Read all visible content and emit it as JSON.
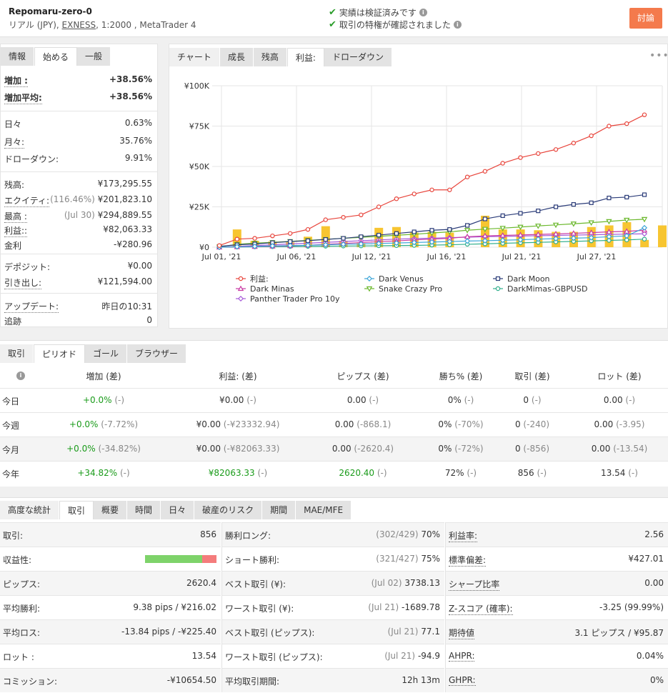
{
  "account": {
    "name": "Repomaru-zero-0",
    "sub_prefix": "リアル (JPY), ",
    "broker": "EXNESS",
    "sub_suffix": ", 1:2000 , MetaTrader 4",
    "verified_1": "実績は検証済みです",
    "verified_2": "取引の特権が確認されました",
    "discuss_label": "討論"
  },
  "left_tabs": [
    "情報",
    "始める",
    "一般"
  ],
  "stats": [
    {
      "k": "増加 :",
      "v": "+38.56%",
      "style": "green"
    },
    {
      "k": "増加平均:",
      "v": "+38.56%",
      "style": "green"
    },
    {
      "k": "日々",
      "v": "0.63%"
    },
    {
      "k": "月々:",
      "v": "35.76%"
    },
    {
      "k": "ドローダウン:",
      "v": "9.91%"
    },
    {
      "k": "残高:",
      "v": "¥173,295.55"
    },
    {
      "k": "エクイティ:",
      "pre": "(116.46%)",
      "v": "¥201,823.10"
    },
    {
      "k": "最高 :",
      "pre": "(Jul 30)",
      "v": "¥294,889.55"
    },
    {
      "k": "利益::",
      "v": "¥82,063.33",
      "style": "green"
    },
    {
      "k": "金利",
      "v": "-¥280.96"
    },
    {
      "k": "デポジット:",
      "v": "¥0.00"
    },
    {
      "k": "引き出し:",
      "v": "¥121,594.00"
    },
    {
      "k": "アップデート:",
      "v": "昨日の10:31"
    },
    {
      "k": "追跡",
      "v": "0"
    }
  ],
  "chart_tabs": [
    "チャート",
    "成長",
    "残高",
    "利益:",
    "ドローダウン"
  ],
  "chart_data": {
    "type": "line",
    "ylabels": [
      "¥100K",
      "¥75K",
      "¥50K",
      "¥25K",
      "¥0"
    ],
    "xlabels": [
      "Jul 01, '21",
      "Jul 06, '21",
      "Jul 12, '21",
      "Jul 16, '21",
      "Jul 21, '21",
      "Jul 27, '21"
    ],
    "ylim": [
      0,
      100000
    ],
    "series": [
      {
        "name": "利益:",
        "color": "#e8453c",
        "marker": "circle",
        "values": [
          1000,
          5000,
          5500,
          7000,
          8500,
          11000,
          17000,
          18500,
          20000,
          25000,
          30000,
          33000,
          35500,
          35500,
          43500,
          47000,
          52000,
          55500,
          58000,
          60500,
          64500,
          69000,
          75000,
          76500,
          82000
        ]
      },
      {
        "name": "Dark Venus",
        "color": "#3ba5d8",
        "marker": "diamond",
        "values": [
          0,
          300,
          500,
          800,
          1000,
          1200,
          1500,
          1800,
          2000,
          2300,
          2600,
          2900,
          3200,
          3500,
          3800,
          4000,
          4300,
          4600,
          5000,
          5300,
          5600,
          5900,
          6500,
          7000,
          12000
        ]
      },
      {
        "name": "Dark Moon",
        "color": "#2a3b78",
        "marker": "square",
        "values": [
          500,
          1500,
          2000,
          2800,
          3500,
          4000,
          4800,
          5500,
          6500,
          7500,
          8500,
          9500,
          10500,
          11000,
          13500,
          17500,
          19500,
          21000,
          22500,
          25000,
          26500,
          27500,
          30500,
          31000,
          32500
        ]
      },
      {
        "name": "Dark Minas",
        "color": "#c93aa3",
        "marker": "triangle",
        "values": [
          0,
          200,
          400,
          600,
          800,
          1200,
          1800,
          2300,
          2900,
          3400,
          3900,
          4500,
          5000,
          5500,
          6500,
          7000,
          7300,
          7600,
          7900,
          8200,
          8600,
          9000,
          9500,
          9800,
          10500
        ]
      },
      {
        "name": "Snake Crazy Pro",
        "color": "#6bb82c",
        "marker": "triangle-down",
        "values": [
          200,
          1800,
          2500,
          3000,
          3600,
          4200,
          4900,
          5500,
          6100,
          6700,
          7400,
          8000,
          8800,
          9500,
          10500,
          11200,
          11800,
          12500,
          13200,
          13800,
          14500,
          15200,
          16000,
          16800,
          17300
        ]
      },
      {
        "name": "DarkMimas-GBPUSD",
        "color": "#2fae8b",
        "marker": "circle",
        "values": [
          0,
          100,
          200,
          300,
          400,
          500,
          600,
          700,
          800,
          900,
          1000,
          1100,
          1300,
          1500,
          1800,
          2100,
          2400,
          2700,
          3000,
          3300,
          3600,
          3900,
          4200,
          4500,
          5000
        ]
      },
      {
        "name": "Panther Trader Pro 10y",
        "color": "#a65ad8",
        "marker": "diamond",
        "values": [
          0,
          500,
          1000,
          1500,
          2000,
          2500,
          3000,
          3500,
          4000,
          4500,
          5000,
          5300,
          5600,
          5900,
          6200,
          6500,
          6700,
          6900,
          7100,
          7300,
          7500,
          7700,
          7900,
          8100,
          8300
        ]
      }
    ],
    "bars": [
      0,
      11000,
      4000,
      3500,
      3000,
      6500,
      13000,
      4000,
      2500,
      12000,
      12500,
      9000,
      9500,
      9000,
      0,
      19500,
      11000,
      11000,
      10500,
      9500,
      9500,
      12500,
      13500,
      15500,
      4500,
      13500
    ],
    "bar_color": "#f7c531"
  },
  "period_tabs": [
    "取引",
    "ピリオド",
    "ゴール",
    "ブラウザー"
  ],
  "period_headers": [
    "増加 (差)",
    "利益: (差)",
    "ピップス (差)",
    "勝ち% (差)",
    "取引 (差)",
    "ロット (差)"
  ],
  "period_rows": [
    {
      "label": "今日",
      "cells": [
        [
          "+0.0%",
          "(-)",
          "g"
        ],
        [
          "¥0.00",
          "(-)",
          ""
        ],
        [
          "0.00",
          "(-)",
          ""
        ],
        [
          "0%",
          "(-)",
          ""
        ],
        [
          "0",
          "(-)",
          ""
        ],
        [
          "0.00",
          "(-)",
          ""
        ]
      ]
    },
    {
      "label": "今週",
      "cells": [
        [
          "+0.0%",
          "(-7.72%)",
          "g"
        ],
        [
          "¥0.00",
          "(-¥23332.94)",
          ""
        ],
        [
          "0.00",
          "(-868.1)",
          ""
        ],
        [
          "0%",
          "(-70%)",
          ""
        ],
        [
          "0",
          "(-240)",
          ""
        ],
        [
          "0.00",
          "(-3.95)",
          ""
        ]
      ]
    },
    {
      "label": "今月",
      "cells": [
        [
          "+0.0%",
          "(-34.82%)",
          "g"
        ],
        [
          "¥0.00",
          "(-¥82063.33)",
          ""
        ],
        [
          "0.00",
          "(-2620.4)",
          ""
        ],
        [
          "0%",
          "(-72%)",
          ""
        ],
        [
          "0",
          "(-856)",
          ""
        ],
        [
          "0.00",
          "(-13.54)",
          ""
        ]
      ]
    },
    {
      "label": "今年",
      "cells": [
        [
          "+34.82%",
          "(-)",
          "g"
        ],
        [
          "¥82063.33",
          "(-)",
          "g"
        ],
        [
          "2620.40",
          "(-)",
          "g"
        ],
        [
          "72%",
          "(-)",
          ""
        ],
        [
          "856",
          "(-)",
          ""
        ],
        [
          "13.54",
          "(-)",
          ""
        ]
      ]
    }
  ],
  "adv_tabs": [
    "高度な統計",
    "取引",
    "概要",
    "時間",
    "日々",
    "破産のリスク",
    "期間",
    "MAE/MFE"
  ],
  "adv_col1": [
    {
      "k": "取引:",
      "v": "856"
    },
    {
      "k": "収益性:",
      "v": "",
      "bar": [
        0.8,
        0.2
      ]
    },
    {
      "k": "ピップス:",
      "v": "2620.4"
    },
    {
      "k": "平均勝利:",
      "v": "9.38 pips / ¥216.02"
    },
    {
      "k": "平均ロス:",
      "v": "-13.84 pips / -¥225.40"
    },
    {
      "k": "ロット :",
      "v": "13.54"
    },
    {
      "k": "コミッション:",
      "v": "-¥10654.50"
    }
  ],
  "adv_col2": [
    {
      "k": "勝利ロング:",
      "pre": "(302/429)",
      "v": "70%"
    },
    {
      "k": "ショート勝利:",
      "pre": "(321/427)",
      "v": "75%"
    },
    {
      "k": "ベスト取引 (¥):",
      "pre": "(Jul 02)",
      "v": "3738.13"
    },
    {
      "k": "ワースト取引 (¥):",
      "pre": "(Jul 21)",
      "v": "-1689.78"
    },
    {
      "k": "ベスト取引 (ピップス):",
      "pre": "(Jul 21)",
      "v": "77.1"
    },
    {
      "k": "ワースト取引 (ピップス):",
      "pre": "(Jul 21)",
      "v": "-94.9"
    },
    {
      "k": "平均取引期間:",
      "v": "12h 13m"
    }
  ],
  "adv_col3": [
    {
      "k": "利益率:",
      "v": "2.56"
    },
    {
      "k": "標準偏差:",
      "v": "¥427.01"
    },
    {
      "k": "シャープ比率",
      "v": "0.00"
    },
    {
      "k": "Z-スコア (確率):",
      "v": "-3.25 (99.99%)"
    },
    {
      "k": "期待値",
      "v": "3.1 ピップス / ¥95.87"
    },
    {
      "k": "AHPR:",
      "v": "0.04%"
    },
    {
      "k": "GHPR:",
      "v": "0%"
    }
  ]
}
